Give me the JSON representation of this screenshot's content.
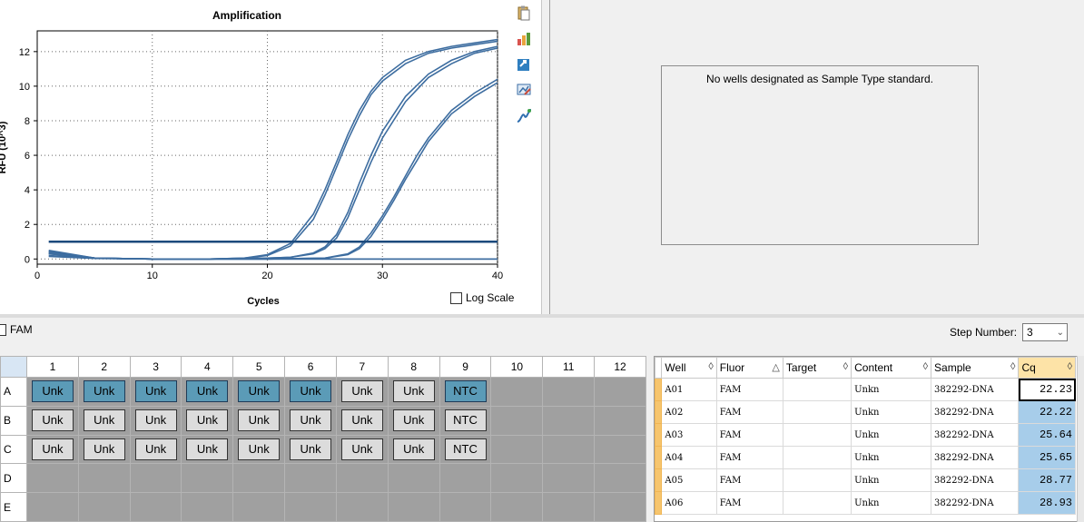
{
  "chart_data": {
    "type": "line",
    "title": "Amplification",
    "xlabel": "Cycles",
    "ylabel": "RFU (10^3)",
    "xlim": [
      0,
      40
    ],
    "ylim": [
      -0.3,
      13.2
    ],
    "xticks": [
      0,
      10,
      20,
      30,
      40
    ],
    "yticks": [
      0,
      2,
      4,
      6,
      8,
      10,
      12
    ],
    "grid": true,
    "threshold": 1.0,
    "series": [
      {
        "values_x": [
          1,
          5,
          10,
          15,
          18,
          20,
          22,
          24,
          25,
          26,
          27,
          28,
          29,
          30,
          32,
          34,
          36,
          38,
          40
        ],
        "values_y": [
          0.4,
          0.05,
          0,
          0,
          0.05,
          0.25,
          0.9,
          2.6,
          4.0,
          5.6,
          7.2,
          8.6,
          9.7,
          10.5,
          11.5,
          12.0,
          12.3,
          12.5,
          12.7
        ]
      },
      {
        "values_x": [
          1,
          5,
          10,
          15,
          18,
          20,
          22,
          24,
          25,
          26,
          27,
          28,
          29,
          30,
          32,
          34,
          36,
          38,
          40
        ],
        "values_y": [
          0.3,
          0.05,
          0,
          0,
          0.05,
          0.2,
          0.75,
          2.3,
          3.7,
          5.3,
          6.9,
          8.3,
          9.5,
          10.3,
          11.3,
          11.9,
          12.2,
          12.4,
          12.6
        ]
      },
      {
        "values_x": [
          1,
          5,
          10,
          15,
          20,
          22,
          24,
          25,
          26,
          27,
          28,
          29,
          30,
          32,
          34,
          36,
          38,
          40
        ],
        "values_y": [
          0.35,
          0.05,
          0,
          0,
          0.05,
          0.1,
          0.35,
          0.7,
          1.4,
          2.7,
          4.4,
          6.0,
          7.4,
          9.4,
          10.7,
          11.5,
          12.0,
          12.3
        ]
      },
      {
        "values_x": [
          1,
          5,
          10,
          15,
          20,
          22,
          24,
          25,
          26,
          27,
          28,
          29,
          30,
          32,
          34,
          36,
          38,
          40
        ],
        "values_y": [
          0.3,
          0.05,
          0,
          0,
          0.05,
          0.1,
          0.3,
          0.6,
          1.2,
          2.4,
          4.0,
          5.6,
          7.0,
          9.1,
          10.5,
          11.3,
          11.9,
          12.2
        ]
      },
      {
        "values_x": [
          1,
          5,
          10,
          15,
          20,
          25,
          27,
          28,
          29,
          30,
          31,
          32,
          33,
          34,
          36,
          38,
          40
        ],
        "values_y": [
          0.5,
          0.05,
          0,
          0,
          0,
          0.05,
          0.3,
          0.7,
          1.5,
          2.5,
          3.6,
          4.8,
          6.0,
          7.0,
          8.6,
          9.6,
          10.4
        ]
      },
      {
        "values_x": [
          1,
          5,
          10,
          15,
          20,
          25,
          27,
          28,
          29,
          30,
          31,
          32,
          33,
          34,
          36,
          38,
          40
        ],
        "values_y": [
          0.45,
          0.05,
          0,
          0,
          0,
          0.05,
          0.25,
          0.6,
          1.3,
          2.3,
          3.4,
          4.6,
          5.7,
          6.8,
          8.4,
          9.4,
          10.2
        ]
      },
      {
        "values_x": [
          1,
          5,
          10,
          20,
          30,
          40
        ],
        "values_y": [
          0.2,
          0.05,
          0,
          0,
          0,
          0
        ]
      },
      {
        "values_x": [
          1,
          5,
          10,
          20,
          30,
          40
        ],
        "values_y": [
          0.15,
          0.03,
          0,
          0,
          0,
          0
        ]
      }
    ],
    "line_color": "#3d6da0",
    "threshold_color": "#1c4a7c"
  },
  "chart": {
    "log_scale_label": "Log Scale"
  },
  "toolbar_icons": [
    "copy-icon",
    "export-chart-icon",
    "export-data-icon",
    "chart-settings-icon",
    "curve-fit-icon"
  ],
  "standard_curve": {
    "message": "No wells designated as Sample Type standard."
  },
  "fluor_filter": {
    "label": "FAM"
  },
  "step": {
    "label": "Step Number:",
    "value": "3"
  },
  "plate": {
    "columns": [
      "1",
      "2",
      "3",
      "4",
      "5",
      "6",
      "7",
      "8",
      "9",
      "10",
      "11",
      "12"
    ],
    "rows": [
      {
        "label": "A",
        "wells": [
          "Unk",
          "Unk",
          "Unk",
          "Unk",
          "Unk",
          "Unk",
          "Unk",
          "Unk",
          "NTC",
          "",
          "",
          ""
        ],
        "selected": [
          true,
          true,
          true,
          true,
          true,
          true,
          false,
          false,
          true,
          false,
          false,
          false
        ]
      },
      {
        "label": "B",
        "wells": [
          "Unk",
          "Unk",
          "Unk",
          "Unk",
          "Unk",
          "Unk",
          "Unk",
          "Unk",
          "NTC",
          "",
          "",
          ""
        ],
        "selected": [
          false,
          false,
          false,
          false,
          false,
          false,
          false,
          false,
          false,
          false,
          false,
          false
        ]
      },
      {
        "label": "C",
        "wells": [
          "Unk",
          "Unk",
          "Unk",
          "Unk",
          "Unk",
          "Unk",
          "Unk",
          "Unk",
          "NTC",
          "",
          "",
          ""
        ],
        "selected": [
          false,
          false,
          false,
          false,
          false,
          false,
          false,
          false,
          false,
          false,
          false,
          false
        ]
      },
      {
        "label": "D",
        "wells": [
          "",
          "",
          "",
          "",
          "",
          "",
          "",
          "",
          "",
          "",
          "",
          ""
        ],
        "selected": []
      },
      {
        "label": "E",
        "wells": [
          "",
          "",
          "",
          "",
          "",
          "",
          "",
          "",
          "",
          "",
          "",
          ""
        ],
        "selected": []
      }
    ]
  },
  "results": {
    "columns": [
      "Well",
      "Fluor",
      "Target",
      "Content",
      "Sample",
      "Cq"
    ],
    "rows": [
      {
        "well": "A01",
        "fluor": "FAM",
        "target": "",
        "content": "Unkn",
        "sample": "382292-DNA",
        "cq": "22.23"
      },
      {
        "well": "A02",
        "fluor": "FAM",
        "target": "",
        "content": "Unkn",
        "sample": "382292-DNA",
        "cq": "22.22"
      },
      {
        "well": "A03",
        "fluor": "FAM",
        "target": "",
        "content": "Unkn",
        "sample": "382292-DNA",
        "cq": "25.64"
      },
      {
        "well": "A04",
        "fluor": "FAM",
        "target": "",
        "content": "Unkn",
        "sample": "382292-DNA",
        "cq": "25.65"
      },
      {
        "well": "A05",
        "fluor": "FAM",
        "target": "",
        "content": "Unkn",
        "sample": "382292-DNA",
        "cq": "28.77"
      },
      {
        "well": "A06",
        "fluor": "FAM",
        "target": "",
        "content": "Unkn",
        "sample": "382292-DNA",
        "cq": "28.93"
      }
    ]
  }
}
